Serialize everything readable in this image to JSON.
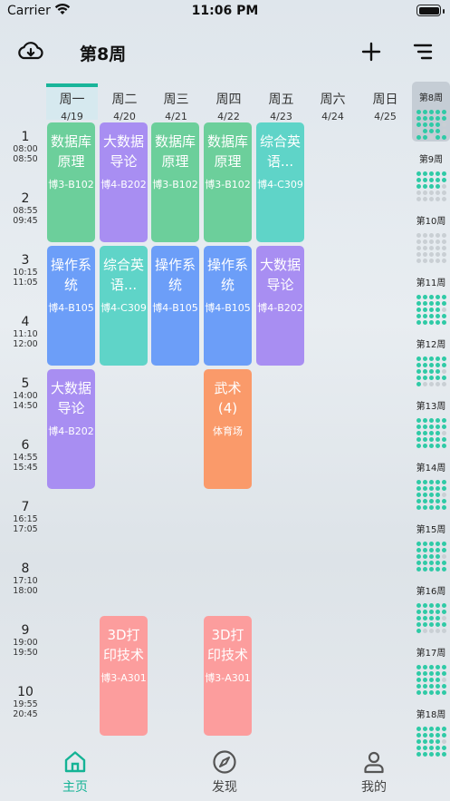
{
  "status": {
    "carrier": "Carrier",
    "time": "11:06 PM"
  },
  "header": {
    "title": "第8周"
  },
  "days": [
    {
      "name": "周一",
      "date": "4/19",
      "active": true
    },
    {
      "name": "周二",
      "date": "4/20"
    },
    {
      "name": "周三",
      "date": "4/21"
    },
    {
      "name": "周四",
      "date": "4/22"
    },
    {
      "name": "周五",
      "date": "4/23"
    },
    {
      "name": "周六",
      "date": "4/24"
    },
    {
      "name": "周日",
      "date": "4/25"
    }
  ],
  "periods": [
    {
      "num": "1",
      "start": "08:00",
      "end": "08:50"
    },
    {
      "num": "2",
      "start": "08:55",
      "end": "09:45"
    },
    {
      "num": "3",
      "start": "10:15",
      "end": "11:05"
    },
    {
      "num": "4",
      "start": "11:10",
      "end": "12:00"
    },
    {
      "num": "5",
      "start": "14:00",
      "end": "14:50"
    },
    {
      "num": "6",
      "start": "14:55",
      "end": "15:45"
    },
    {
      "num": "7",
      "start": "16:15",
      "end": "17:05"
    },
    {
      "num": "8",
      "start": "17:10",
      "end": "18:00"
    },
    {
      "num": "9",
      "start": "19:00",
      "end": "19:50"
    },
    {
      "num": "10",
      "start": "19:55",
      "end": "20:45"
    }
  ],
  "courses": [
    {
      "name": "数据库原理",
      "room": "博3-B102",
      "day": 1,
      "start": 1,
      "span": 2,
      "color": "#6ccf9b"
    },
    {
      "name": "大数据导论",
      "room": "博4-B202",
      "day": 2,
      "start": 1,
      "span": 2,
      "color": "#a88ef2"
    },
    {
      "name": "数据库原理",
      "room": "博3-B102",
      "day": 3,
      "start": 1,
      "span": 2,
      "color": "#6ccf9b"
    },
    {
      "name": "数据库原理",
      "room": "博3-B102",
      "day": 4,
      "start": 1,
      "span": 2,
      "color": "#6ccf9b"
    },
    {
      "name": "综合英语...",
      "room": "博4-C309",
      "day": 5,
      "start": 1,
      "span": 2,
      "color": "#5fd4c8"
    },
    {
      "name": "操作系统",
      "room": "博4-B105",
      "day": 1,
      "start": 3,
      "span": 2,
      "color": "#6c9ef8"
    },
    {
      "name": "综合英语...",
      "room": "博4-C309",
      "day": 2,
      "start": 3,
      "span": 2,
      "color": "#5fd4c8"
    },
    {
      "name": "操作系统",
      "room": "博4-B105",
      "day": 3,
      "start": 3,
      "span": 2,
      "color": "#6c9ef8"
    },
    {
      "name": "操作系统",
      "room": "博4-B105",
      "day": 4,
      "start": 3,
      "span": 2,
      "color": "#6c9ef8"
    },
    {
      "name": "大数据导论",
      "room": "博4-B202",
      "day": 5,
      "start": 3,
      "span": 2,
      "color": "#a88ef2"
    },
    {
      "name": "大数据导论",
      "room": "博4-B202",
      "day": 1,
      "start": 5,
      "span": 2,
      "color": "#a88ef2"
    },
    {
      "name": "武术(4)",
      "room": "体育场",
      "day": 4,
      "start": 5,
      "span": 2,
      "color": "#fa9a6a"
    },
    {
      "name": "3D打印技术",
      "room": "博3-A301",
      "day": 2,
      "start": 9,
      "span": 2,
      "color": "#fc9d9d"
    },
    {
      "name": "3D打印技术",
      "room": "博3-A301",
      "day": 4,
      "start": 9,
      "span": 2,
      "color": "#fc9d9d"
    }
  ],
  "weeks": [
    {
      "label": "第8周",
      "current": true,
      "on": [
        0,
        1,
        2,
        3,
        4,
        5,
        6,
        7,
        8,
        9,
        10,
        11,
        12,
        13,
        16,
        17,
        18,
        20,
        21,
        23,
        24
      ]
    },
    {
      "label": "第9周",
      "on": [
        0,
        1,
        2,
        3,
        4,
        5,
        6,
        7,
        8,
        9,
        10,
        11,
        12,
        13
      ]
    },
    {
      "label": "第10周",
      "on": []
    },
    {
      "label": "第11周",
      "on": [
        0,
        1,
        2,
        3,
        4,
        5,
        6,
        7,
        8,
        9,
        10,
        11,
        12,
        13,
        15,
        16,
        17,
        18,
        19,
        20,
        21,
        22,
        23,
        24
      ]
    },
    {
      "label": "第12周",
      "on": [
        0,
        1,
        2,
        3,
        4,
        5,
        6,
        7,
        8,
        9,
        10,
        11,
        12,
        13,
        15,
        16,
        17,
        18,
        19,
        20
      ]
    },
    {
      "label": "第13周",
      "on": [
        0,
        1,
        2,
        3,
        4,
        5,
        6,
        7,
        8,
        9,
        10,
        11,
        12,
        13,
        15,
        16,
        17,
        18,
        19,
        20,
        21,
        22,
        23,
        24
      ]
    },
    {
      "label": "第14周",
      "on": [
        0,
        1,
        2,
        3,
        4,
        5,
        6,
        7,
        8,
        9,
        10,
        11,
        12,
        13,
        15,
        16,
        17,
        18,
        19,
        20,
        21,
        22,
        23,
        24
      ]
    },
    {
      "label": "第15周",
      "on": [
        0,
        1,
        2,
        3,
        4,
        5,
        6,
        7,
        8,
        9,
        10,
        11,
        12,
        13,
        15,
        16,
        17,
        18,
        19,
        20,
        21,
        22,
        23,
        24
      ]
    },
    {
      "label": "第16周",
      "on": [
        0,
        1,
        2,
        3,
        4,
        5,
        6,
        7,
        8,
        9,
        10,
        11,
        12,
        13,
        15,
        16,
        17,
        18,
        19,
        20
      ]
    },
    {
      "label": "第17周",
      "on": [
        0,
        1,
        2,
        3,
        4,
        5,
        6,
        7,
        8,
        9,
        10,
        11,
        12,
        13,
        15,
        16,
        17,
        18,
        19,
        20,
        21,
        22,
        23,
        24
      ]
    },
    {
      "label": "第18周",
      "on": [
        0,
        1,
        2,
        3,
        4,
        5,
        6,
        7,
        8,
        9,
        10,
        11,
        12,
        13,
        15,
        16,
        17,
        18,
        19,
        20,
        21,
        22,
        23,
        24
      ]
    }
  ],
  "tabs": [
    {
      "label": "主页",
      "icon": "home-icon",
      "active": true
    },
    {
      "label": "发现",
      "icon": "compass-icon"
    },
    {
      "label": "我的",
      "icon": "person-icon"
    }
  ],
  "colors": {
    "accent": "#14b395"
  }
}
